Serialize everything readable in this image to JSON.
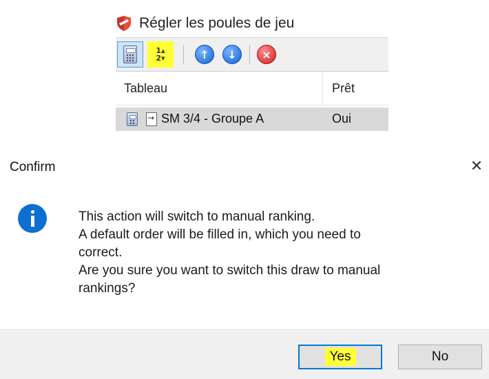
{
  "background_window": {
    "title": "Régler les poules de jeu",
    "toolbar": {
      "buttons": [
        {
          "name": "calculator",
          "state": "selected"
        },
        {
          "name": "sort-numeric",
          "state": "highlighted",
          "glyph_top": "1▴",
          "glyph_bottom": "2▾"
        },
        {
          "name": "move-up",
          "glyph": "↑"
        },
        {
          "name": "move-down",
          "glyph": "↓"
        },
        {
          "name": "delete",
          "glyph": "×"
        }
      ]
    },
    "list": {
      "columns": [
        "Tableau",
        "Prêt"
      ],
      "rows": [
        {
          "tableau": "SM 3/4 - Groupe A",
          "pret": "Oui"
        }
      ]
    }
  },
  "dialog": {
    "title": "Confirm",
    "close_glyph": "✕",
    "icon": "info-icon",
    "message_lines": [
      "This action will switch to manual ranking.",
      "A default order will be filled in, which you need to",
      "correct.",
      "Are you sure you want to switch this draw to manual",
      "rankings?"
    ],
    "buttons": {
      "yes": "Yes",
      "no": "No"
    }
  },
  "colors": {
    "highlight": "#ffff33",
    "focus_border": "#0078d7",
    "info_blue": "#0d6fd1",
    "button_bar": "#f0f0f0"
  }
}
